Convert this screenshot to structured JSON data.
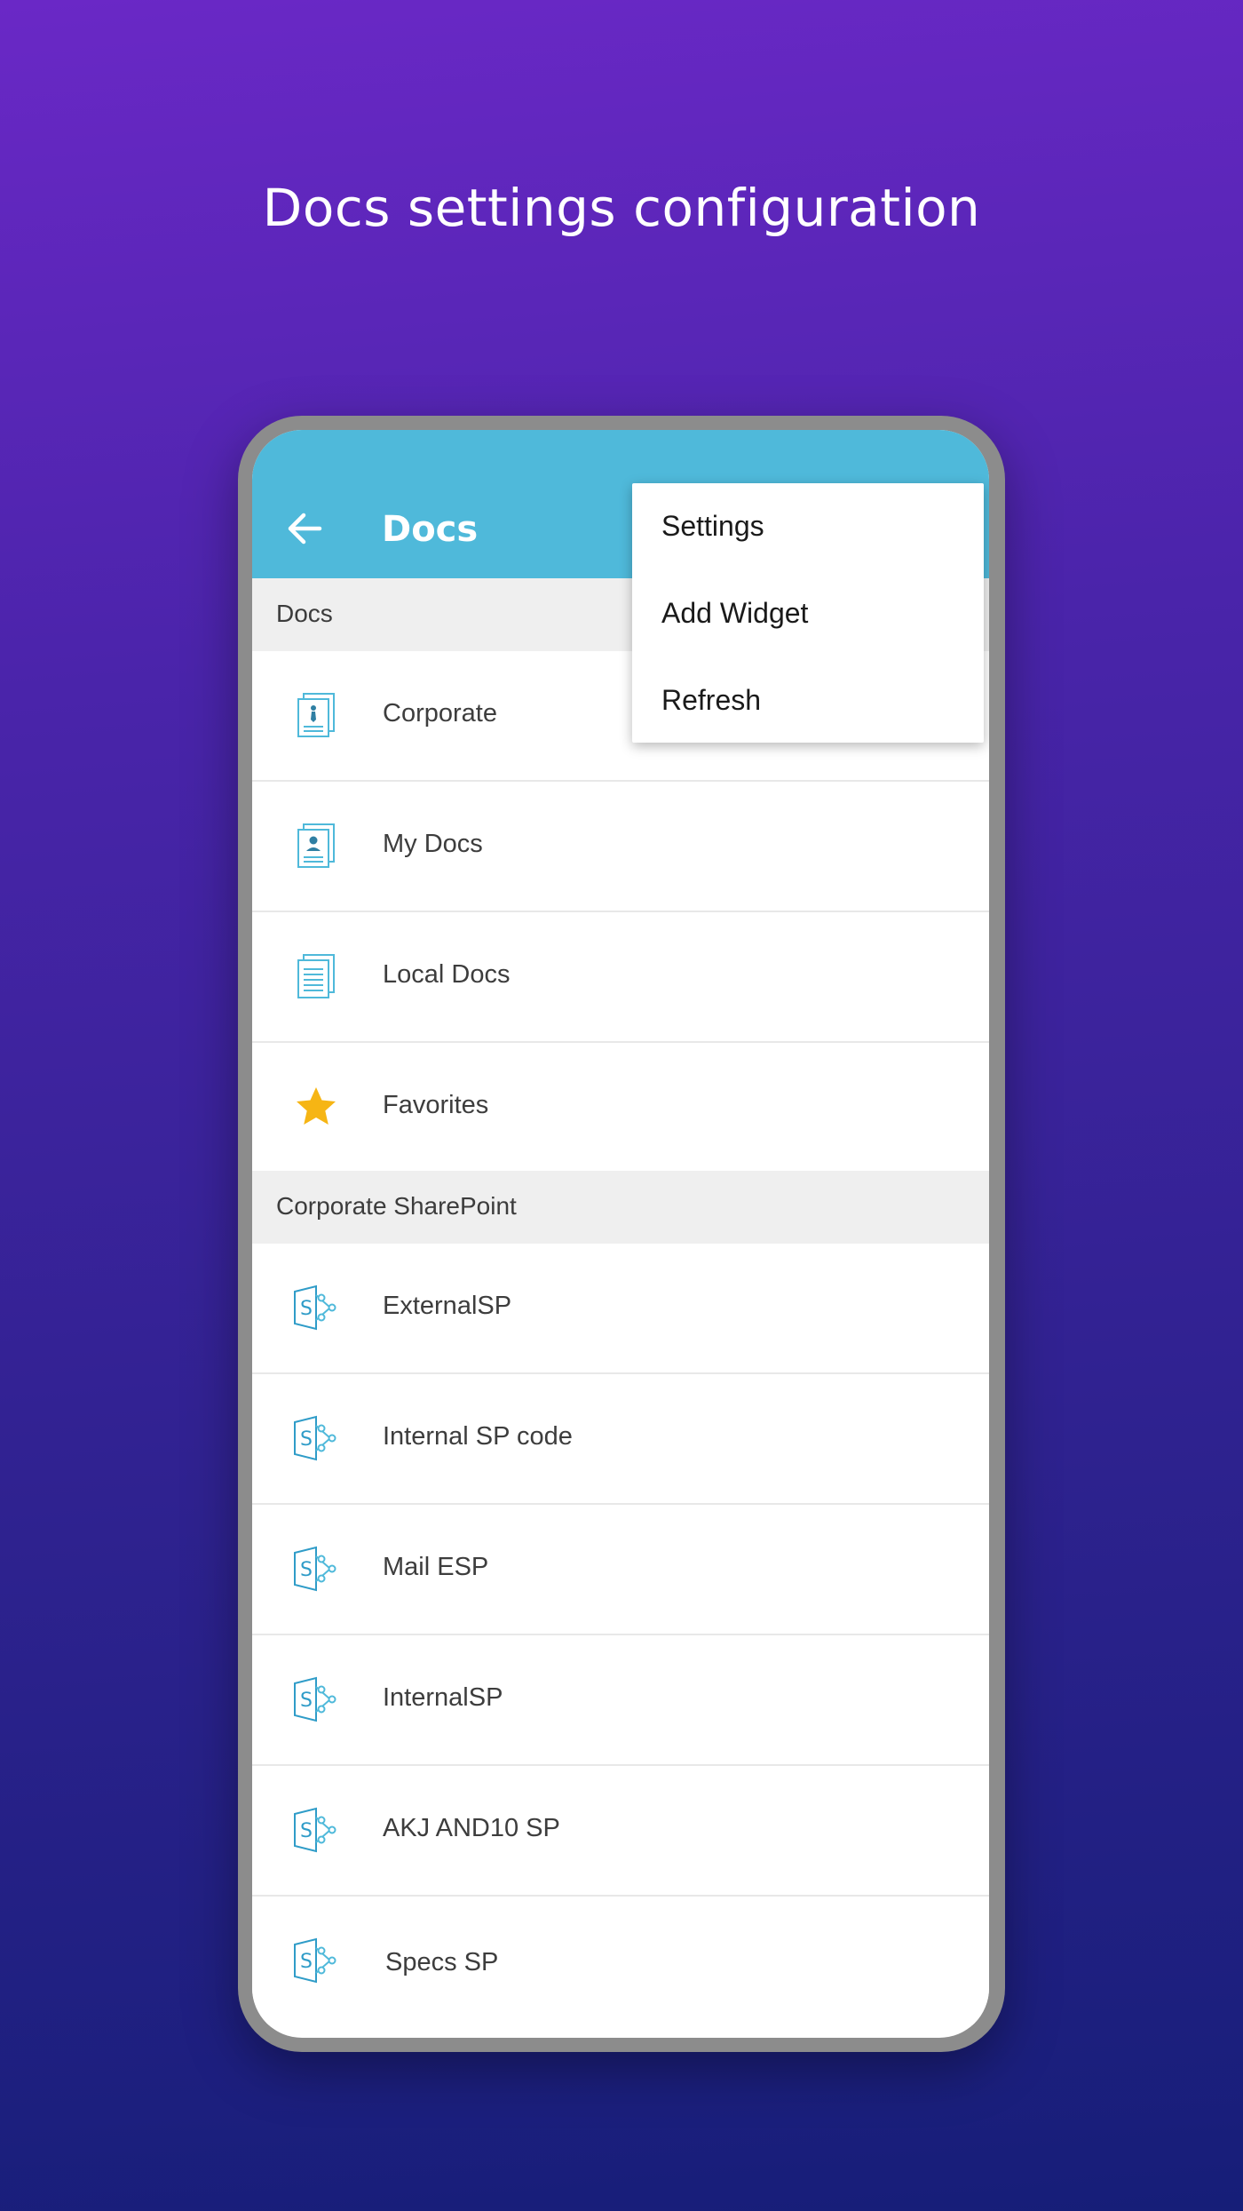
{
  "headline": "Docs settings configuration",
  "appbar": {
    "title": "Docs",
    "back_icon": "arrow-left-icon",
    "color": "#4fb9da"
  },
  "menu": {
    "items": [
      {
        "label": "Settings"
      },
      {
        "label": "Add Widget"
      },
      {
        "label": "Refresh"
      }
    ]
  },
  "sections": [
    {
      "header": "Docs",
      "items": [
        {
          "label": "Corporate",
          "icon": "corporate-doc-icon"
        },
        {
          "label": "My Docs",
          "icon": "my-docs-icon"
        },
        {
          "label": "Local Docs",
          "icon": "local-docs-icon"
        },
        {
          "label": "Favorites",
          "icon": "star-icon"
        }
      ]
    },
    {
      "header": "Corporate SharePoint",
      "items": [
        {
          "label": "ExternalSP",
          "icon": "sharepoint-icon"
        },
        {
          "label": "Internal SP code",
          "icon": "sharepoint-icon"
        },
        {
          "label": "Mail ESP",
          "icon": "sharepoint-icon"
        },
        {
          "label": "InternalSP",
          "icon": "sharepoint-icon"
        },
        {
          "label": "AKJ AND10 SP",
          "icon": "sharepoint-icon"
        },
        {
          "label": "Specs SP",
          "icon": "sharepoint-icon"
        }
      ]
    }
  ],
  "colors": {
    "icon_blue": "#4fb9da",
    "star": "#f6b514",
    "section_bg": "#efefef"
  }
}
